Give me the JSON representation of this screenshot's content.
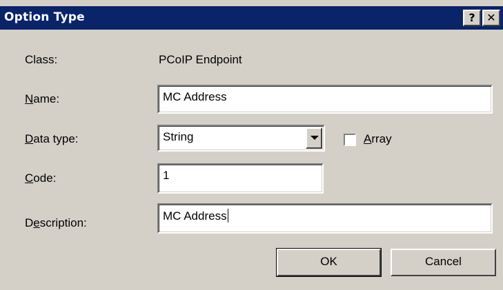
{
  "window": {
    "title": "Option Type",
    "help_label": "?",
    "close_label": "✕"
  },
  "form": {
    "class_label": "Class:",
    "class_value": "PCoIP Endpoint",
    "name_label": "Name:",
    "name_value": "MC Address",
    "datatype_label": "Data type:",
    "datatype_value": "String",
    "array_label": "Array",
    "array_checked": false,
    "code_label": "Code:",
    "code_value": "1",
    "description_label": "Description:",
    "description_value": "MC Address"
  },
  "buttons": {
    "ok_label": "OK",
    "cancel_label": "Cancel"
  },
  "colors": {
    "titlebar": "#0a246a",
    "face": "#d4d0c8"
  }
}
